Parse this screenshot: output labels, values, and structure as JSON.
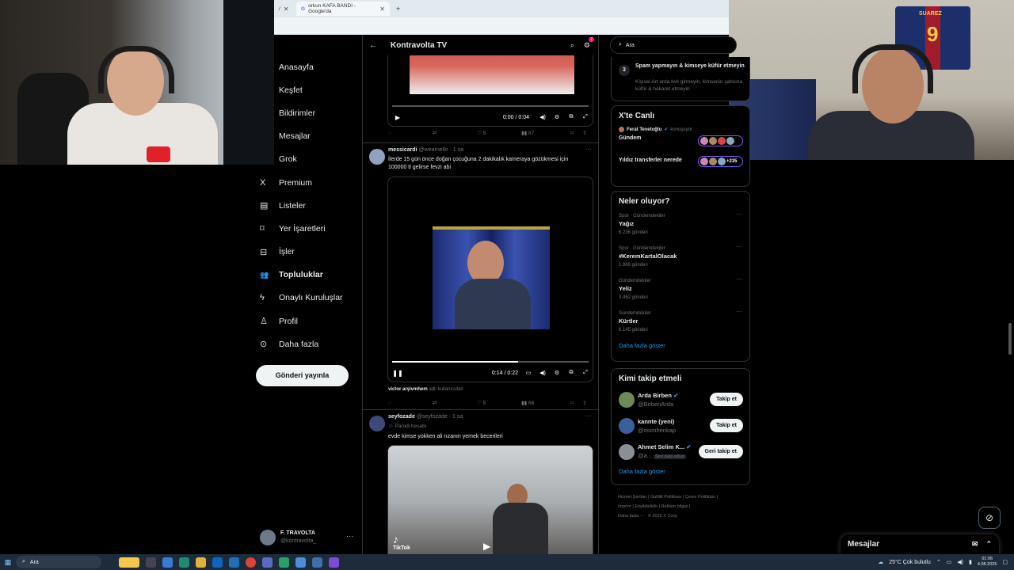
{
  "browser": {
    "tabs": [
      {
        "label": "/"
      },
      {
        "label": "orkun KAFA BANDI - Google'da"
      }
    ],
    "new_tab": "+"
  },
  "left_nav": {
    "items": [
      {
        "label": "Anasayfa",
        "icon": "home-icon",
        "glyph": ""
      },
      {
        "label": "Keşfet",
        "icon": "search-icon",
        "glyph": ""
      },
      {
        "label": "Bildirimler",
        "icon": "bell-icon",
        "glyph": ""
      },
      {
        "label": "Mesajlar",
        "icon": "mail-icon",
        "glyph": ""
      },
      {
        "label": "Grok",
        "icon": "grok-icon",
        "glyph": ""
      },
      {
        "label": "Premium",
        "icon": "x-logo-icon",
        "glyph": "X"
      },
      {
        "label": "Listeler",
        "icon": "list-icon",
        "glyph": "▤"
      },
      {
        "label": "Yer İşaretleri",
        "icon": "bookmark-icon",
        "glyph": "⌑"
      },
      {
        "label": "İşler",
        "icon": "briefcase-icon",
        "glyph": "⊟"
      },
      {
        "label": "Topluluklar",
        "icon": "communities-icon",
        "glyph": "👥"
      },
      {
        "label": "Onaylı Kuruluşlar",
        "icon": "lightning-icon",
        "glyph": "ϟ"
      },
      {
        "label": "Profil",
        "icon": "person-icon",
        "glyph": "♙"
      },
      {
        "label": "Daha fazla",
        "icon": "more-circle-icon",
        "glyph": "⊙"
      }
    ],
    "post_button": "Gönderi yayınla",
    "profile": {
      "name": "F. TRAVOLTA",
      "handle": "@kontravolta_",
      "more": "···"
    }
  },
  "main": {
    "title": "Kontravolta TV",
    "back": "←",
    "notif_count": "7",
    "video1": {
      "time": "0:00 / 0:04",
      "progress": 0
    },
    "post1_actions": {
      "likes": "5",
      "views": "87"
    },
    "post2": {
      "author": "messicardi",
      "handle": "@wearnello · 1 sa",
      "text": "İlerde 15 gün önce doğan çocuğuna 2 dakikalık kameraya gözükmesi için 100000 tl gelirse fevzi abi",
      "video_time": "0:14 / 0:22",
      "progress": 0.64,
      "attribution_name": "victor arşivmhem",
      "attribution_rest": "adlı kullanıcıdan",
      "likes": "5",
      "views": "68"
    },
    "post3": {
      "author": "seyfozade",
      "handle": "@seyfozade · 1 sa",
      "label": "Parodi hesabı",
      "text": "evde kimse yokken ali rızanın yemek becerileri",
      "watermark": "TikTok"
    }
  },
  "right": {
    "search_placeholder": "Ara",
    "rules": {
      "number": "3",
      "title": "Spam yapmayın & kimseye küfür etmeyin",
      "body": "Kişisel Art arda twit girmeyin, kimsenin şahsına küfür & hakaret etmeyin"
    },
    "live": {
      "title": "X'te Canlı",
      "host": "Ferat Tevetoğlu",
      "host_status": "konuşuyor",
      "rows": [
        {
          "label": "Gündem",
          "extra": ""
        },
        {
          "label": "Yıldız transferler nerede",
          "extra": "+235"
        }
      ]
    },
    "trends": {
      "title": "Neler oluyor?",
      "items": [
        {
          "category": "Spor · Gündemdekiler",
          "name": "Yağız",
          "count": "6.236 gönderi"
        },
        {
          "category": "Spor · Gündemdekiler",
          "name": "#KeremKartalOlacak",
          "count": "1.869 gönderi"
        },
        {
          "category": "Gündemdekiler",
          "name": "Yeliz",
          "count": "3.462 gönderi"
        },
        {
          "category": "Gündemdekiler",
          "name": "Kürtler",
          "count": "6.145 gönderi"
        }
      ],
      "show_more": "Daha fazla göster"
    },
    "who_to_follow": {
      "title": "Kimi takip etmeli",
      "items": [
        {
          "name": "Arda Birben",
          "handle": "@BirbenArda",
          "button": "Takip et"
        },
        {
          "name": "kannte (yeni)",
          "handle": "@osimhenkap",
          "button": "Takip et"
        },
        {
          "name": "Ahmet Selim K...",
          "handle": "@a...",
          "follows_you": "Seni takip ediyor",
          "button": "Geri takip et"
        }
      ],
      "show_more": "Daha fazla göster"
    },
    "footer": {
      "links": [
        "Hizmet Şartları",
        "Gizlilik Politikası",
        "Çerez Politikası",
        "Imprint",
        "Erişilebilirlik",
        "Reklam bilgisi"
      ],
      "more": "Daha fazla ···",
      "copyright": "© 2025 X Corp."
    }
  },
  "messages_drawer": {
    "title": "Mesajlar"
  },
  "webcam_right": {
    "jersey_name": "SUAREZ",
    "jersey_number": "9"
  },
  "taskbar": {
    "search": "Ara",
    "weather": "25°C  Çok bulutlu",
    "time": "01:06",
    "date": "4.08.2025"
  },
  "colors": {
    "accent": "#1d9bf0",
    "verified": "#1d9bf0",
    "live_border": "#7856ff",
    "background": "#000000"
  }
}
